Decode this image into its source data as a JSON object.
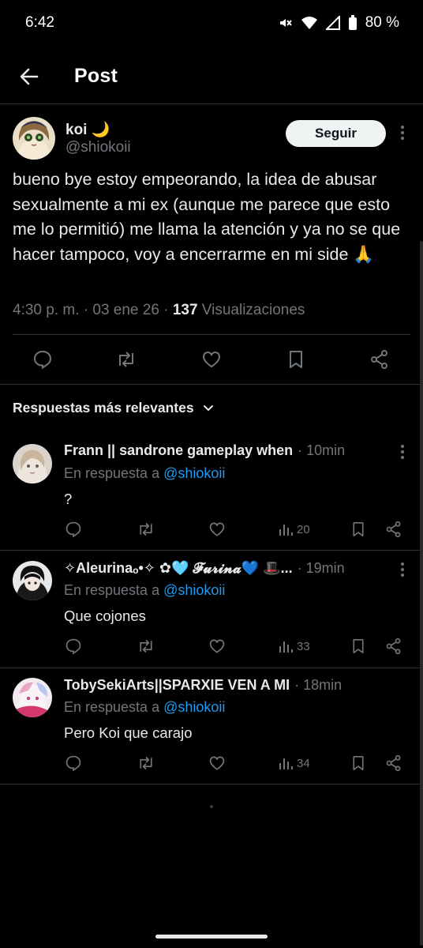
{
  "status_bar": {
    "time": "6:42",
    "battery": "80 %"
  },
  "header": {
    "title": "Post"
  },
  "post": {
    "author_name": "koi 🌙",
    "handle": "@shiokoii",
    "follow_label": "Seguir",
    "text": "bueno bye estoy empeorando, la idea de abusar sexualmente a mi ex (aunque me parece que esto me lo permitió) me llama la atención y ya no se que hacer tampoco, voy a encerrarme en mi side 🙏",
    "time": "4:30 p. m.",
    "date": "03 ene 26",
    "views_count": "137",
    "views_label": "Visualizaciones"
  },
  "replies_section": {
    "title": "Respuestas más relevantes"
  },
  "replies": [
    {
      "name": "Frann || sandrone gameplay when",
      "time": "10min",
      "reply_to_prefix": "En respuesta a",
      "reply_to_handle": "@shiokoii",
      "text": "?",
      "views": "20"
    },
    {
      "name": "✧Aleurinaₒ•✧ ✿🩵 𝓕𝓾𝓻𝓲𝓷𝓪💙 🎩...",
      "time": "19min",
      "reply_to_prefix": "En respuesta a",
      "reply_to_handle": "@shiokoii",
      "text": "Que cojones",
      "views": "33"
    },
    {
      "name": "TobySekiArts||SPARXIE VEN A MI",
      "time": "18min",
      "reply_to_prefix": "En respuesta a",
      "reply_to_handle": "@shiokoii",
      "text": "Pero Koi que carajo",
      "views": "34"
    }
  ],
  "icons": {
    "back": "arrow-left-icon",
    "reply": "speech-bubble-icon",
    "repost": "repost-arrows-icon",
    "like": "heart-icon",
    "views": "bar-chart-icon",
    "bookmark": "bookmark-icon",
    "share": "share-icon",
    "more": "three-dots-vertical-icon",
    "chevron": "chevron-down-icon"
  },
  "colors": {
    "background": "#000000",
    "text": "#e7e9ea",
    "secondary": "#71767b",
    "link": "#1d9bf0",
    "button_bg": "#eff3f4",
    "divider": "#2f3336"
  }
}
